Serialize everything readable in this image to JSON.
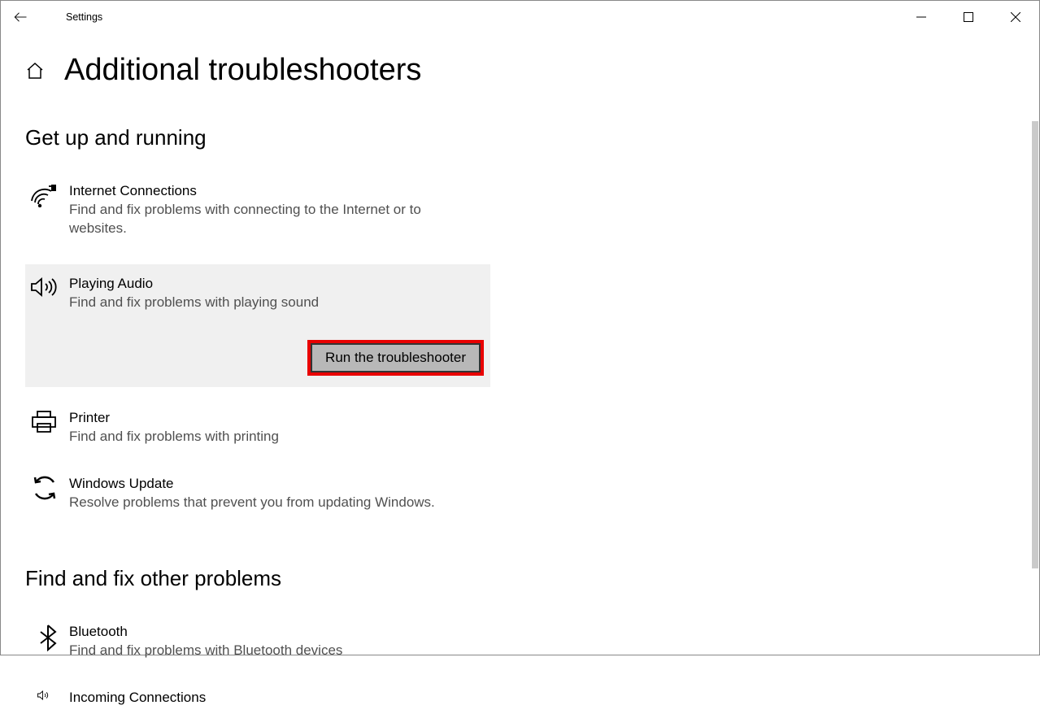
{
  "app_title": "Settings",
  "page_title": "Additional troubleshooters",
  "section1": {
    "title": "Get up and running",
    "items": [
      {
        "title": "Internet Connections",
        "desc": "Find and fix problems with connecting to the Internet or to websites."
      },
      {
        "title": "Playing Audio",
        "desc": "Find and fix problems with playing sound"
      },
      {
        "title": "Printer",
        "desc": "Find and fix problems with printing"
      },
      {
        "title": "Windows Update",
        "desc": "Resolve problems that prevent you from updating Windows."
      }
    ]
  },
  "run_button_label": "Run the troubleshooter",
  "section2": {
    "title": "Find and fix other problems",
    "items": [
      {
        "title": "Bluetooth",
        "desc": "Find and fix problems with Bluetooth devices"
      },
      {
        "title": "Incoming Connections",
        "desc": ""
      }
    ]
  },
  "colors": {
    "highlight_red": "#e80000",
    "selected_bg": "#f0f0f0",
    "btn_bg": "#b8b8b8"
  }
}
